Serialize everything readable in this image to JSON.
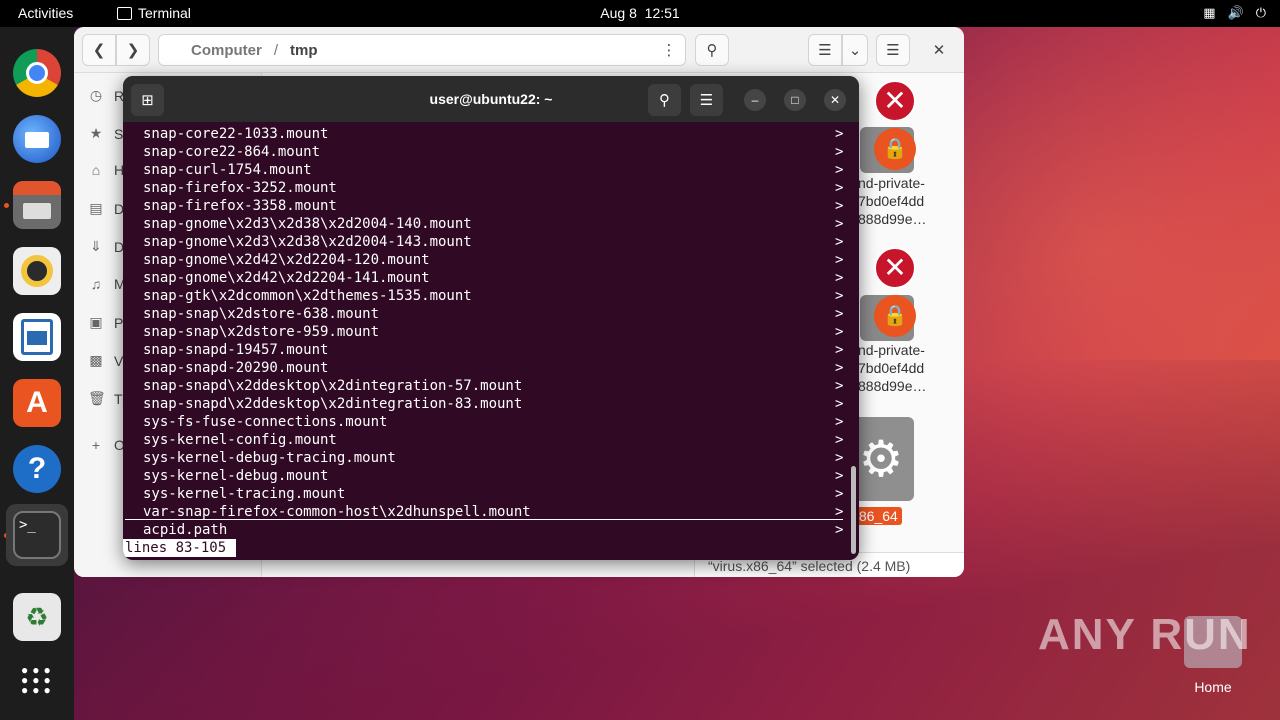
{
  "topbar": {
    "activities": "Activities",
    "app_name": "Terminal",
    "date": "Aug 8",
    "time": "12:51",
    "tray_icons": [
      "network-icon",
      "volume-icon",
      "power-icon"
    ]
  },
  "dock": {
    "apps": [
      {
        "name": "chrome",
        "color": "#4285f4"
      },
      {
        "name": "thunderbird",
        "color": "#2f6bd6"
      },
      {
        "name": "files",
        "color": "#d94c2f"
      },
      {
        "name": "rhythmbox",
        "color": "#f3c53e"
      },
      {
        "name": "libreoffice-writer",
        "color": "#2a6ab1"
      },
      {
        "name": "app-center",
        "color": "#e95420"
      },
      {
        "name": "help",
        "color": "#1e6ec8"
      },
      {
        "name": "terminal",
        "color": "#2c2c2c"
      },
      {
        "name": "trash",
        "color": "#bdbdbd"
      },
      {
        "name": "show-apps",
        "color": "#ffffff"
      }
    ]
  },
  "files": {
    "path_root": "Computer",
    "path_current": "tmp",
    "sidebar_items": [
      {
        "label": "R",
        "icon": "clock-icon"
      },
      {
        "label": "S",
        "icon": "star-icon"
      },
      {
        "label": "H",
        "icon": "home-icon"
      },
      {
        "label": "D",
        "icon": "document-icon"
      },
      {
        "label": "D",
        "icon": "download-icon"
      },
      {
        "label": "M",
        "icon": "music-icon"
      },
      {
        "label": "P",
        "icon": "picture-icon"
      },
      {
        "label": "V",
        "icon": "video-icon"
      },
      {
        "label": "Tr",
        "icon": "trash-icon"
      },
      {
        "label": "O",
        "icon": "plus-icon"
      }
    ],
    "items": [
      {
        "line1": "nd-private-",
        "line2": "7bd0ef4dd",
        "line3": "888d99e…"
      },
      {
        "line1": "nd-private-",
        "line2": "7bd0ef4dd",
        "line3": "888d99e…"
      }
    ],
    "selected_label": ".x86_64",
    "status": "“virus.x86_64” selected  (2.4 MB)"
  },
  "terminal": {
    "title": "user@ubuntu22: ~",
    "lines": [
      "snap-core22-1033.mount",
      "snap-core22-864.mount",
      "snap-curl-1754.mount",
      "snap-firefox-3252.mount",
      "snap-firefox-3358.mount",
      "snap-gnome\\x2d3\\x2d38\\x2d2004-140.mount",
      "snap-gnome\\x2d3\\x2d38\\x2d2004-143.mount",
      "snap-gnome\\x2d42\\x2d2204-120.mount",
      "snap-gnome\\x2d42\\x2d2204-141.mount",
      "snap-gtk\\x2dcommon\\x2dthemes-1535.mount",
      "snap-snap\\x2dstore-638.mount",
      "snap-snap\\x2dstore-959.mount",
      "snap-snapd-19457.mount",
      "snap-snapd-20290.mount",
      "snap-snapd\\x2ddesktop\\x2dintegration-57.mount",
      "snap-snapd\\x2ddesktop\\x2dintegration-83.mount",
      "sys-fs-fuse-connections.mount",
      "sys-kernel-config.mount",
      "sys-kernel-debug-tracing.mount",
      "sys-kernel-debug.mount",
      "sys-kernel-tracing.mount",
      "var-snap-firefox-common-host\\x2dhunspell.mount",
      "acpid.path"
    ],
    "more_marker": ">",
    "pager_status": "lines 83-105"
  },
  "desktop": {
    "watermark": "ANY RUN",
    "home_label": "Home"
  }
}
